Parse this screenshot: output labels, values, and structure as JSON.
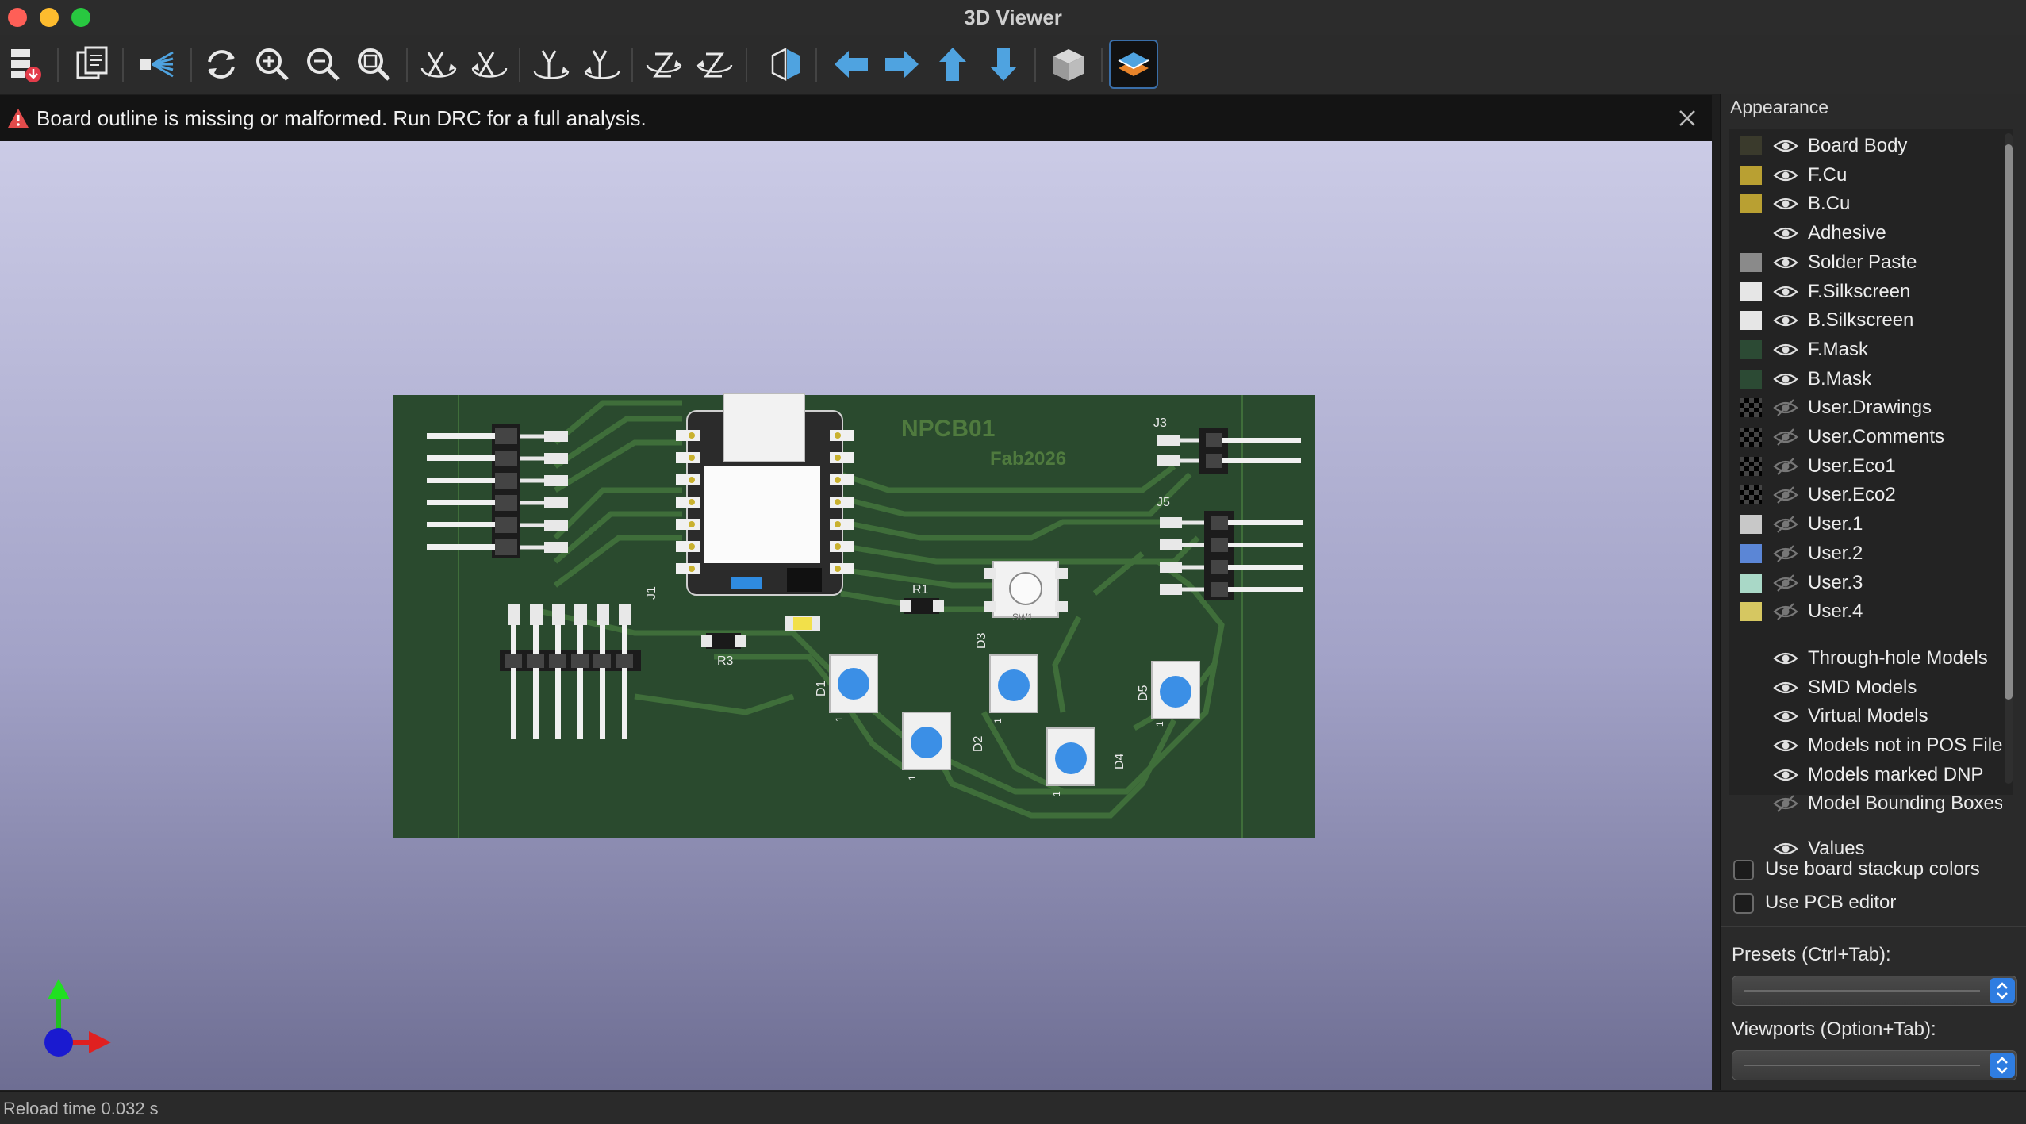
{
  "window": {
    "title": "3D Viewer"
  },
  "toolbar": {
    "icons": [
      "export-image-icon",
      "copy-image-icon",
      "raytrace-icon",
      "reload-icon",
      "zoom-in-icon",
      "zoom-out-icon",
      "zoom-fit-icon",
      "rotate-x-cw-icon",
      "rotate-x-ccw-icon",
      "rotate-y-cw-icon",
      "rotate-y-ccw-icon",
      "rotate-z-cw-icon",
      "rotate-z-ccw-icon",
      "flip-board-icon",
      "pan-left-icon",
      "pan-right-icon",
      "pan-up-icon",
      "pan-down-icon",
      "ortho-view-icon",
      "layers-manager-icon"
    ],
    "accent": "#4fa3e0"
  },
  "infobar": {
    "message": "Board outline is missing or malformed. Run DRC for a full analysis."
  },
  "board": {
    "silk_name": "NPCB01",
    "silk_sub": "Fab2026",
    "refs": {
      "j3": "J3",
      "j5": "J5",
      "j1": "J1",
      "r1": "R1",
      "r3": "R3",
      "d1": "D1",
      "d2": "D2",
      "d3": "D3",
      "d4": "D4",
      "d5": "D5",
      "sw1": "SW1",
      "pin1": "1"
    },
    "colors": {
      "board": "#2a4a2e",
      "trace": "#3f6e3a",
      "pad": "#d9d9d9",
      "led": "#3b8fe6"
    }
  },
  "appearance": {
    "title": "Appearance",
    "layers": [
      {
        "name": "Board Body",
        "color": "#3a3a2c",
        "visible": true
      },
      {
        "name": "F.Cu",
        "color": "#b9a032",
        "visible": true
      },
      {
        "name": "B.Cu",
        "color": "#b9a032",
        "visible": true
      },
      {
        "name": "Adhesive",
        "color": "",
        "visible": true
      },
      {
        "name": "Solder Paste",
        "color": "#8a8a8a",
        "visible": true
      },
      {
        "name": "F.Silkscreen",
        "color": "#e6e6e6",
        "visible": true
      },
      {
        "name": "B.Silkscreen",
        "color": "#e6e6e6",
        "visible": true
      },
      {
        "name": "F.Mask",
        "color": "#2c4a34",
        "visible": true
      },
      {
        "name": "B.Mask",
        "color": "#2c4a34",
        "visible": true
      },
      {
        "name": "User.Drawings",
        "color": "checker",
        "visible": false
      },
      {
        "name": "User.Comments",
        "color": "checker",
        "visible": false
      },
      {
        "name": "User.Eco1",
        "color": "checker",
        "visible": false
      },
      {
        "name": "User.Eco2",
        "color": "checker",
        "visible": false
      },
      {
        "name": "User.1",
        "color": "#c8c8c8",
        "visible": false
      },
      {
        "name": "User.2",
        "color": "#5b86d6",
        "visible": false
      },
      {
        "name": "User.3",
        "color": "#a9d8c7",
        "visible": false
      },
      {
        "name": "User.4",
        "color": "#d6c761",
        "visible": false
      }
    ],
    "models": [
      {
        "name": "Through-hole Models",
        "visible": true
      },
      {
        "name": "SMD Models",
        "visible": true
      },
      {
        "name": "Virtual Models",
        "visible": true
      },
      {
        "name": "Models not in POS File",
        "visible": true
      },
      {
        "name": "Models marked DNP",
        "visible": true
      },
      {
        "name": "Model Bounding Boxes",
        "visible": false
      }
    ],
    "values_label": "Values",
    "use_stackup_colors": "Use board stackup colors",
    "use_pcb_editor": "Use PCB editor",
    "presets_label": "Presets (Ctrl+Tab):",
    "viewports_label": "Viewports (Option+Tab):"
  },
  "status": {
    "reload": "Reload time 0.032 s"
  }
}
